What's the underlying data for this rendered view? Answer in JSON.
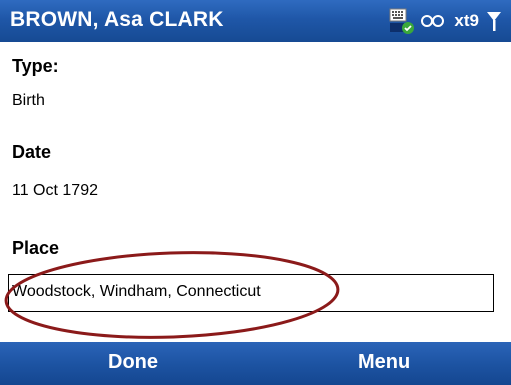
{
  "titlebar": {
    "title": "BROWN, Asa CLARK",
    "input_mode": "xt9"
  },
  "fields": {
    "type_label": "Type:",
    "type_value": "Birth",
    "date_label": "Date",
    "date_value": "11 Oct 1792",
    "place_label": "Place",
    "place_value": "Woodstock, Windham, Connecticut"
  },
  "softkeys": {
    "left": "Done",
    "right": "Menu"
  },
  "colors": {
    "bar_blue": "#1f57a8",
    "annotation": "#8b1a1a"
  },
  "icons": [
    "keyboard-icon",
    "predictive-text-icon",
    "signal-icon"
  ]
}
